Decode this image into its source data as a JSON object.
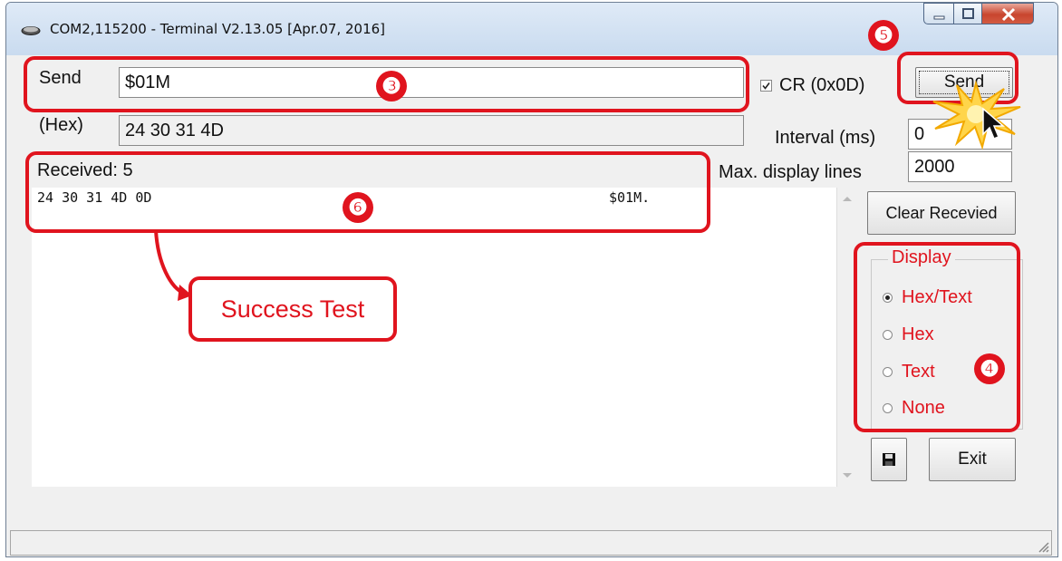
{
  "window": {
    "title": "COM2,115200 - Terminal V2.13.05 [Apr.07, 2016]",
    "controls": {
      "minimize": "minimize-icon",
      "maximize": "maximize-icon",
      "close": "close-icon"
    }
  },
  "send": {
    "label": "Send",
    "value": "$01M",
    "hex_label": "(Hex)",
    "hex_value": "24 30 31 4D",
    "cr_label": "CR (0x0D)",
    "cr_checked": true,
    "button": "Send"
  },
  "interval": {
    "label": "Interval (ms)",
    "value": "0"
  },
  "max_lines": {
    "label": "Max. display lines",
    "value": "2000"
  },
  "received": {
    "label": "Received: 5",
    "hex": "24 30 31 4D 0D",
    "text": "$01M."
  },
  "clear_button": "Clear Recevied",
  "display": {
    "legend": "Display",
    "options": [
      "Hex/Text",
      "Hex",
      "Text",
      "None"
    ],
    "selected": "Hex/Text"
  },
  "exit_button": "Exit",
  "annotations": {
    "badge_3": "❸",
    "badge_4": "❹",
    "badge_5": "❺",
    "badge_6": "❻",
    "callout": "Success Test"
  },
  "colors": {
    "highlight": "#e0141e",
    "radio_text": "#e0141e"
  }
}
